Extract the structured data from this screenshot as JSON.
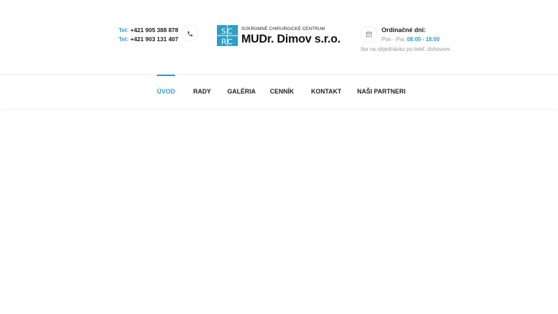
{
  "contact": {
    "phone1_label": "Tel:",
    "phone1_number": "+421 905 388 878",
    "phone2_label": "Tel:",
    "phone2_number": "+421 903 131 407"
  },
  "logo": {
    "mark_top": "SC",
    "mark_bottom": "RC",
    "subtitle": "SÚKROMNÉ CHIRURGICKÉ CENTRUM",
    "name": "MUDr. Dimov s.r.o."
  },
  "hours": {
    "title": "Ordinačné dni:",
    "days": "Pon - Pia:",
    "time": "08:00 - 18:00",
    "note": "Iba na objednávku po telef. dohovore."
  },
  "nav": {
    "items": [
      "ÚVOD",
      "RADY",
      "GALÉRIA",
      "CENNÍK",
      "KONTAKT",
      "NAŠI PARTNERI"
    ]
  },
  "colors": {
    "accent": "#2a9fc8",
    "text": "#222222",
    "muted": "#999999"
  },
  "icons": {
    "phone": "phone-icon",
    "calendar": "calendar-icon"
  }
}
